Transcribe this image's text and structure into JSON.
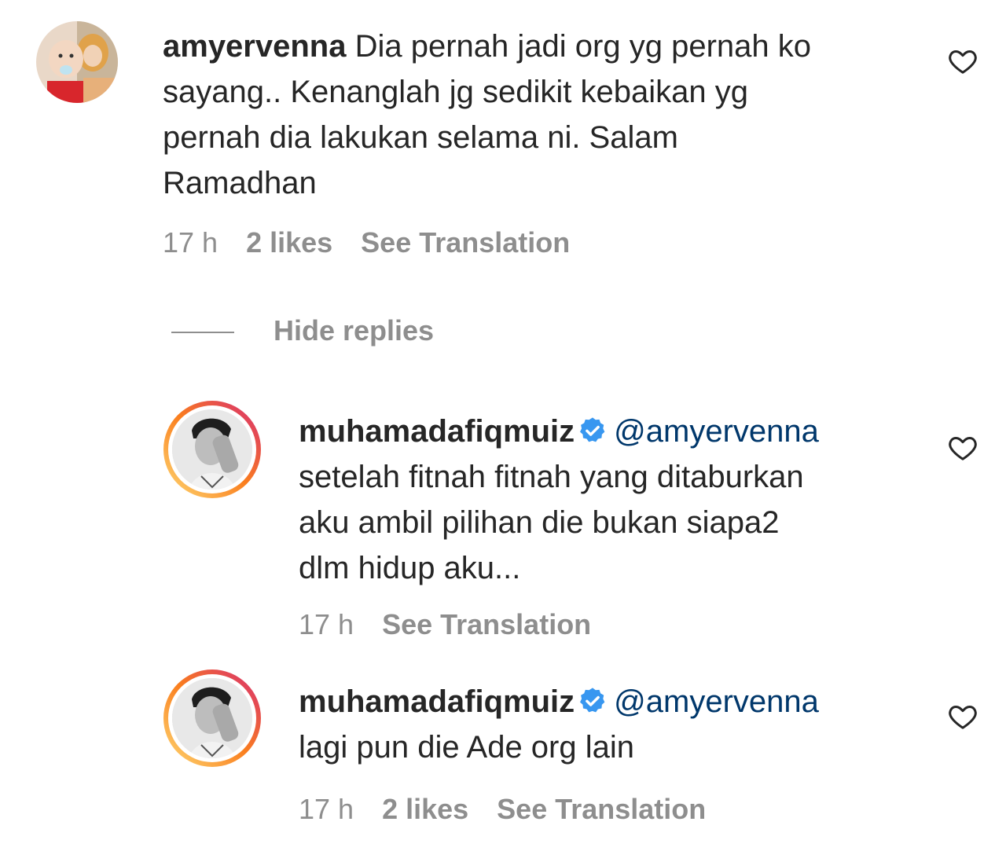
{
  "comments": [
    {
      "username": "amyervenna",
      "text_lines": [
        "Dia pernah jadi org yg pernah ko",
        "sayang.. Kenanglah jg sedikit kebaikan yg",
        "pernah dia lakukan selama ni. Salam",
        "Ramadhan"
      ],
      "time": "17 h",
      "likes": "2 likes",
      "translate": "See Translation",
      "avatar_icon": "profile-photo-mother-child-icon"
    }
  ],
  "hide_replies": "Hide replies",
  "replies": [
    {
      "username": "muhamadafiqmuiz",
      "mention": "@amyervenna",
      "text_lines": [
        "setelah fitnah fitnah yang ditaburkan",
        "aku ambil pilihan die bukan siapa2",
        "dlm hidup aku..."
      ],
      "time": "17 h",
      "translate": "See Translation",
      "avatar_icon": "profile-photo-man-bw-icon"
    },
    {
      "username": "muhamadafiqmuiz",
      "mention": "@amyervenna",
      "text_lines": [
        "lagi pun die Ade org lain"
      ],
      "time": "17 h",
      "likes": "2 likes",
      "translate": "See Translation",
      "avatar_icon": "profile-photo-man-bw-icon"
    }
  ],
  "colors": {
    "text": "#262626",
    "secondary": "#8e8e8e",
    "mention": "#00376b",
    "verified": "#3897f0",
    "story_ring_start": "#feda75",
    "story_ring_end": "#d62976"
  }
}
